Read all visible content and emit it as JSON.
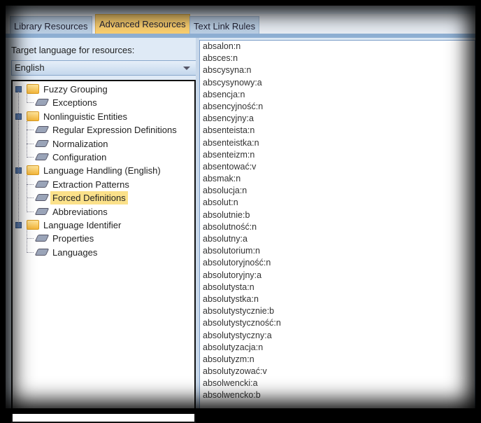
{
  "tabs": [
    {
      "label": "Library Resources"
    },
    {
      "label": "Advanced Resources",
      "active": true
    },
    {
      "label": "Text Link Rules"
    }
  ],
  "left": {
    "target_label": "Target language for resources:",
    "language": "English"
  },
  "tree": [
    {
      "label": "Fuzzy Grouping",
      "type": "folder"
    },
    {
      "label": "Exceptions",
      "type": "leaf"
    },
    {
      "label": "Nonlinguistic Entities",
      "type": "folder"
    },
    {
      "label": "Regular Expression Definitions",
      "type": "leaf"
    },
    {
      "label": "Normalization",
      "type": "leaf"
    },
    {
      "label": "Configuration",
      "type": "leaf"
    },
    {
      "label": "Language Handling (English)",
      "type": "folder"
    },
    {
      "label": "Extraction Patterns",
      "type": "leaf"
    },
    {
      "label": "Forced Definitions",
      "type": "leaf",
      "selected": true
    },
    {
      "label": "Abbreviations",
      "type": "leaf"
    },
    {
      "label": "Language Identifier",
      "type": "folder"
    },
    {
      "label": "Properties",
      "type": "leaf"
    },
    {
      "label": "Languages",
      "type": "leaf"
    }
  ],
  "entries": [
    "absalon:n",
    "absces:n",
    "abscysyna:n",
    "abscysynowy:a",
    "absencja:n",
    "absencyjność:n",
    "absencyjny:a",
    "absenteista:n",
    "absenteistka:n",
    "absenteizm:n",
    "absentować:v",
    "absmak:n",
    "absolucja:n",
    "absolut:n",
    "absolutnie:b",
    "absolutność:n",
    "absolutny:a",
    "absolutorium:n",
    "absolutoryjność:n",
    "absolutoryjny:a",
    "absolutysta:n",
    "absolutystka:n",
    "absolutystycznie:b",
    "absolutystyczność:n",
    "absolutystyczny:a",
    "absolutyzacja:n",
    "absolutyzm:n",
    "absolutyzować:v",
    "absolwencki:a",
    "absolwencko:b"
  ]
}
